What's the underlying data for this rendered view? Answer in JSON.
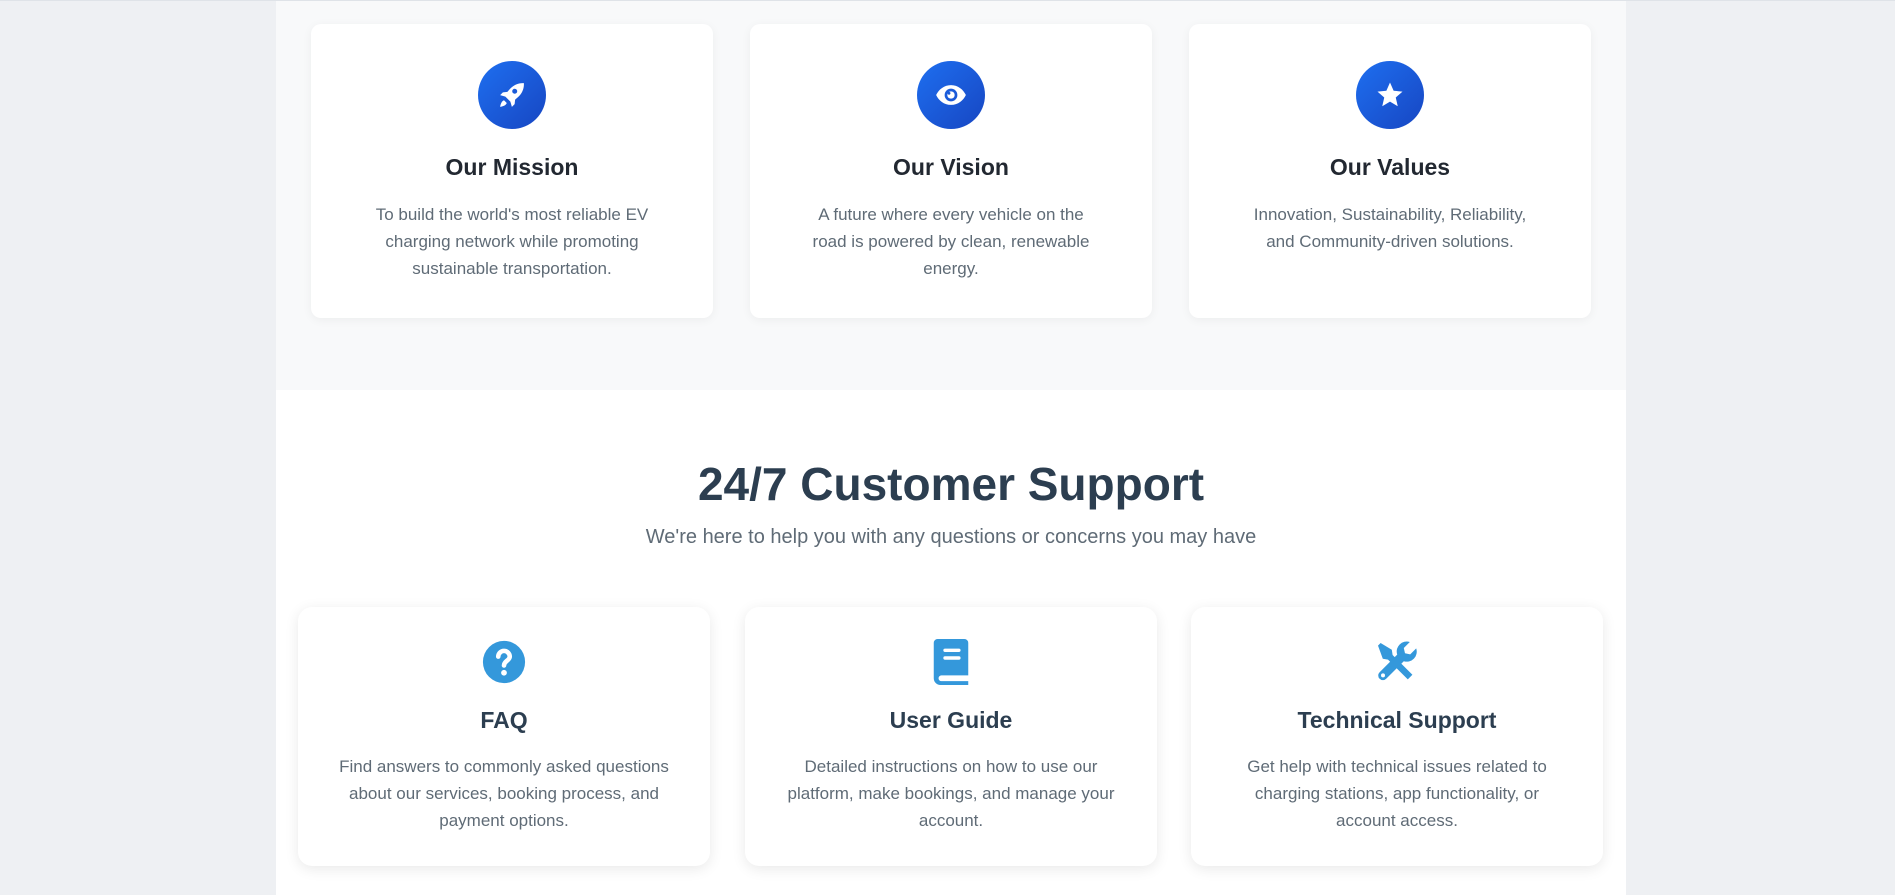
{
  "about": {
    "cards": [
      {
        "icon": "rocket-icon",
        "title": "Our Mission",
        "text": "To build the world's most reliable EV charging network while promoting sustainable transportation."
      },
      {
        "icon": "eye-icon",
        "title": "Our Vision",
        "text": "A future where every vehicle on the road is powered by clean, renewable energy."
      },
      {
        "icon": "star-icon",
        "title": "Our Values",
        "text": "Innovation, Sustainability, Reliability, and Community-driven solutions."
      }
    ],
    "icon_gradient": [
      "#1e6ff0",
      "#1746c2"
    ]
  },
  "support": {
    "heading": "24/7 Customer Support",
    "subheading": "We're here to help you with any questions or concerns you may have",
    "icon_color": "#3498db",
    "cards": [
      {
        "icon": "question-circle-icon",
        "title": "FAQ",
        "text": "Find answers to commonly asked questions about our services, booking process, and payment options."
      },
      {
        "icon": "book-icon",
        "title": "User Guide",
        "text": "Detailed instructions on how to use our platform, make bookings, and manage your account."
      },
      {
        "icon": "tools-icon",
        "title": "Technical Support",
        "text": "Get help with technical issues related to charging stations, app functionality, or account access."
      }
    ]
  }
}
